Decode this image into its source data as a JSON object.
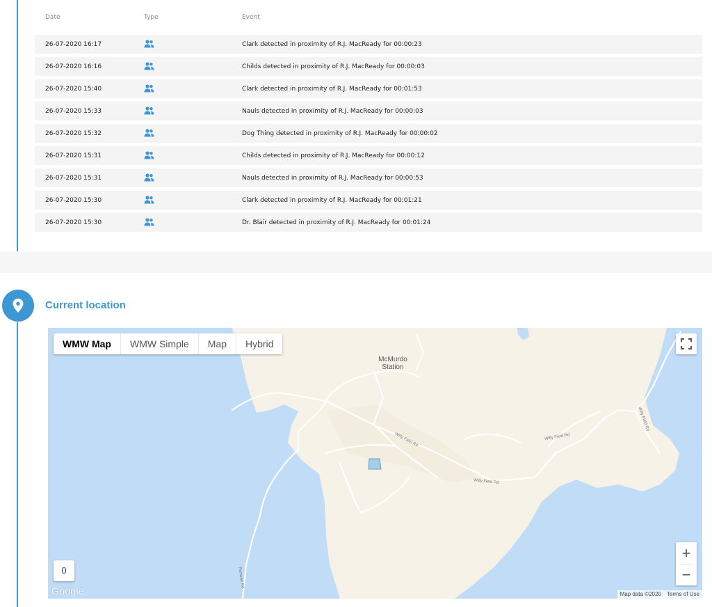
{
  "table": {
    "headers": {
      "date": "Date",
      "type": "Type",
      "event": "Event"
    },
    "rows": [
      {
        "date": "26-07-2020 16:17",
        "type_icon": "people-icon",
        "event": "Clark detected in proximity of R.J. MacReady for 00:00:23"
      },
      {
        "date": "26-07-2020 16:16",
        "type_icon": "people-icon",
        "event": "Childs detected in proximity of R.J. MacReady for 00:00:03"
      },
      {
        "date": "26-07-2020 15:40",
        "type_icon": "people-icon",
        "event": "Clark detected in proximity of R.J. MacReady for 00:01:53"
      },
      {
        "date": "26-07-2020 15:33",
        "type_icon": "people-icon",
        "event": "Nauls detected in proximity of R.J. MacReady for 00:00:03"
      },
      {
        "date": "26-07-2020 15:32",
        "type_icon": "people-icon",
        "event": "Dog Thing detected in proximity of R.J. MacReady for 00:00:02"
      },
      {
        "date": "26-07-2020 15:31",
        "type_icon": "people-icon",
        "event": "Childs detected in proximity of R.J. MacReady for 00:00:12"
      },
      {
        "date": "26-07-2020 15:31",
        "type_icon": "people-icon",
        "event": "Nauls detected in proximity of R.J. MacReady for 00:00:53"
      },
      {
        "date": "26-07-2020 15:30",
        "type_icon": "people-icon",
        "event": "Clark detected in proximity of R.J. MacReady for 00:01:21"
      },
      {
        "date": "26-07-2020 15:30",
        "type_icon": "people-icon",
        "event": "Dr. Blair detected in proximity of R.J. MacReady for 00:01:24"
      }
    ]
  },
  "location": {
    "title": "Current location",
    "icon": "map-pin-icon"
  },
  "map": {
    "types": [
      "WMW Map",
      "WMW Simple",
      "Map",
      "Hybrid"
    ],
    "active_type": "WMW Map",
    "station_label_line1": "McMurdo",
    "station_label_line2": "Station",
    "road_labels": [
      "Willy Field Rd",
      "Willy Field Rd",
      "Willy Field Rd",
      "Willy Field Rd",
      "Runway Rd"
    ],
    "zoom_in": "+",
    "zoom_out": "−",
    "zero_button": "0",
    "logo": "Google",
    "attribution": "Map data ©2020",
    "terms": "Terms of Use"
  },
  "colors": {
    "accent": "#3d97d3",
    "water": "#c0dcf7",
    "land": "#f6f2e8",
    "row_bg": "#f4f4f4"
  }
}
